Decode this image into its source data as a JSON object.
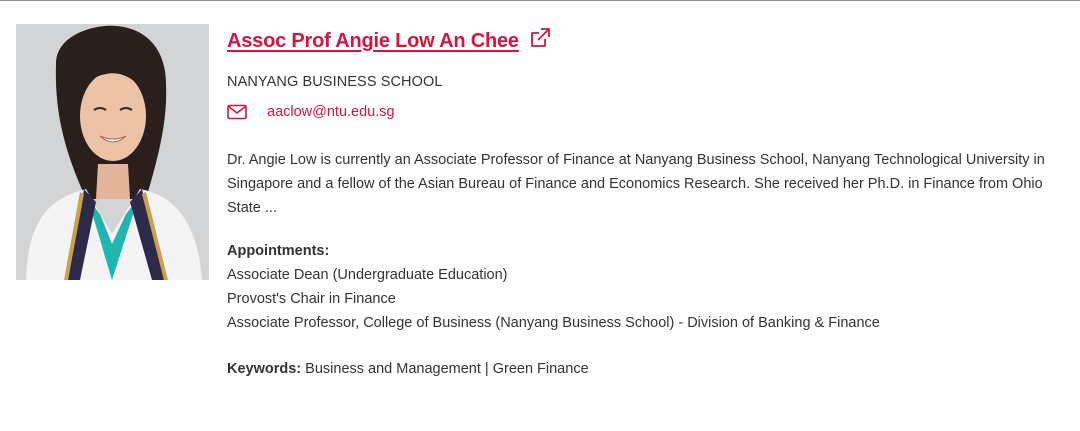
{
  "profile": {
    "name": "Assoc Prof Angie Low An Chee",
    "school": "NANYANG BUSINESS SCHOOL",
    "email": "aaclow@ntu.edu.sg",
    "bio": "Dr. Angie Low is currently an Associate Professor of Finance at Nanyang Business School, Nanyang Technological University in Singapore and a fellow of the Asian Bureau of Finance and Economics Research. She received her Ph.D. in Finance from Ohio State ...",
    "appointments_heading": "Appointments:",
    "appointments": [
      "Associate Dean (Undergraduate Education)",
      "Provost's Chair in Finance",
      "Associate Professor, College of Business (Nanyang Business School) - Division of Banking & Finance"
    ],
    "keywords_label": "Keywords:",
    "keywords_value": "Business and Management | Green Finance"
  },
  "icons": {
    "external_link": "external-link-icon",
    "email": "envelope-icon"
  },
  "colors": {
    "accent": "#d71440",
    "text": "#333333",
    "divider": "#8c8c8c"
  }
}
